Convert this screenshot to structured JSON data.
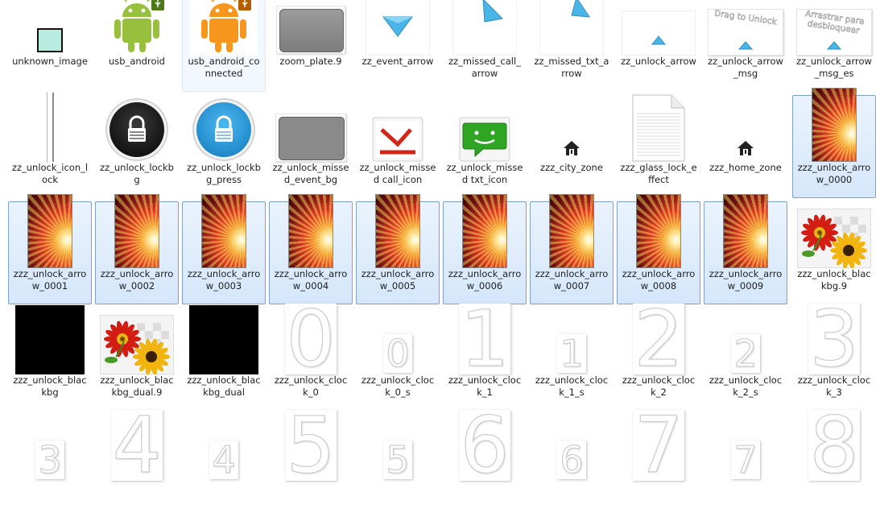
{
  "explorer": {
    "rows": [
      [
        {
          "label": "unknown_image",
          "thumb": "unknown"
        },
        {
          "label": "usb_android",
          "thumb": "android-green"
        },
        {
          "label": "usb_android_connected",
          "thumb": "android-orange",
          "state": "hover"
        },
        {
          "label": "zoom_plate.9",
          "thumb": "plate"
        },
        {
          "label": "zz_event_arrow",
          "thumb": "arrow-down"
        },
        {
          "label": "zz_missed_call_arrow",
          "thumb": "arrow-left-up"
        },
        {
          "label": "zz_missed_txt_arrow",
          "thumb": "arrow-left-up-2"
        },
        {
          "label": "zz_unlock_arrow",
          "thumb": "up-small"
        },
        {
          "label": "zz_unlock_arrow_msg",
          "thumb": "drag-msg",
          "text": "Drag to Unlock"
        },
        {
          "label": "zz_unlock_arrow_msg_es",
          "thumb": "drag-msg",
          "text": "Arrastrar para desbloquear"
        }
      ],
      [
        {
          "label": "zz_unlock_icon_lock",
          "thumb": "bar"
        },
        {
          "label": "zz_unlock_lockbg",
          "thumb": "lock-black"
        },
        {
          "label": "zz_unlock_lockbg_press",
          "thumb": "lock-blue"
        },
        {
          "label": "zz_unlock_missed_event_bg",
          "thumb": "grey-box"
        },
        {
          "label": "zz_unlock_missed call_icon",
          "thumb": "missed-call"
        },
        {
          "label": "zz_unlock_missed txt_icon",
          "thumb": "missed-txt"
        },
        {
          "label": "zzz_city_zone",
          "thumb": "house"
        },
        {
          "label": "zzz_glass_lock_effect",
          "thumb": "doc"
        },
        {
          "label": "zzz_home_zone",
          "thumb": "house"
        },
        {
          "label": "zzz_unlock_arrow_0000",
          "thumb": "burst",
          "state": "selected"
        }
      ],
      [
        {
          "label": "zzz_unlock_arrow_0001",
          "thumb": "burst",
          "state": "selected"
        },
        {
          "label": "zzz_unlock_arrow_0002",
          "thumb": "burst",
          "state": "selected"
        },
        {
          "label": "zzz_unlock_arrow_0003",
          "thumb": "burst",
          "state": "selected"
        },
        {
          "label": "zzz_unlock_arrow_0004",
          "thumb": "burst",
          "state": "selected"
        },
        {
          "label": "zzz_unlock_arrow_0005",
          "thumb": "burst",
          "state": "selected"
        },
        {
          "label": "zzz_unlock_arrow_0006",
          "thumb": "burst",
          "state": "selected"
        },
        {
          "label": "zzz_unlock_arrow_0007",
          "thumb": "burst",
          "state": "selected"
        },
        {
          "label": "zzz_unlock_arrow_0008",
          "thumb": "burst",
          "state": "selected"
        },
        {
          "label": "zzz_unlock_arrow_0009",
          "thumb": "burst",
          "state": "selected"
        },
        {
          "label": "zzz_unlock_blackbg.9",
          "thumb": "flowers"
        }
      ],
      [
        {
          "label": "zzz_unlock_blackbg",
          "thumb": "black"
        },
        {
          "label": "zzz_unlock_blackbg_dual.9",
          "thumb": "flowers"
        },
        {
          "label": "zzz_unlock_blackbg_dual",
          "thumb": "black"
        },
        {
          "label": "zzz_unlock_clock_0",
          "thumb": "digit-big",
          "text": "0"
        },
        {
          "label": "zzz_unlock_clock_0_s",
          "thumb": "digit-small",
          "text": "0"
        },
        {
          "label": "zzz_unlock_clock_1",
          "thumb": "digit-big",
          "text": "1"
        },
        {
          "label": "zzz_unlock_clock_1_s",
          "thumb": "digit-small",
          "text": "1"
        },
        {
          "label": "zzz_unlock_clock_2",
          "thumb": "digit-big",
          "text": "2"
        },
        {
          "label": "zzz_unlock_clock_2_s",
          "thumb": "digit-small",
          "text": "2"
        },
        {
          "label": "zzz_unlock_clock_3",
          "thumb": "digit-big",
          "text": "3"
        }
      ],
      [
        {
          "label": "",
          "thumb": "digit-small",
          "text": "3"
        },
        {
          "label": "",
          "thumb": "digit-big",
          "text": "4"
        },
        {
          "label": "",
          "thumb": "digit-small",
          "text": "4"
        },
        {
          "label": "",
          "thumb": "digit-big",
          "text": "5"
        },
        {
          "label": "",
          "thumb": "digit-small",
          "text": "5"
        },
        {
          "label": "",
          "thumb": "digit-big",
          "text": "6"
        },
        {
          "label": "",
          "thumb": "digit-small",
          "text": "6"
        },
        {
          "label": "",
          "thumb": "digit-big",
          "text": "7"
        },
        {
          "label": "",
          "thumb": "digit-small",
          "text": "7"
        },
        {
          "label": "",
          "thumb": "digit-big",
          "text": "8"
        }
      ]
    ]
  }
}
